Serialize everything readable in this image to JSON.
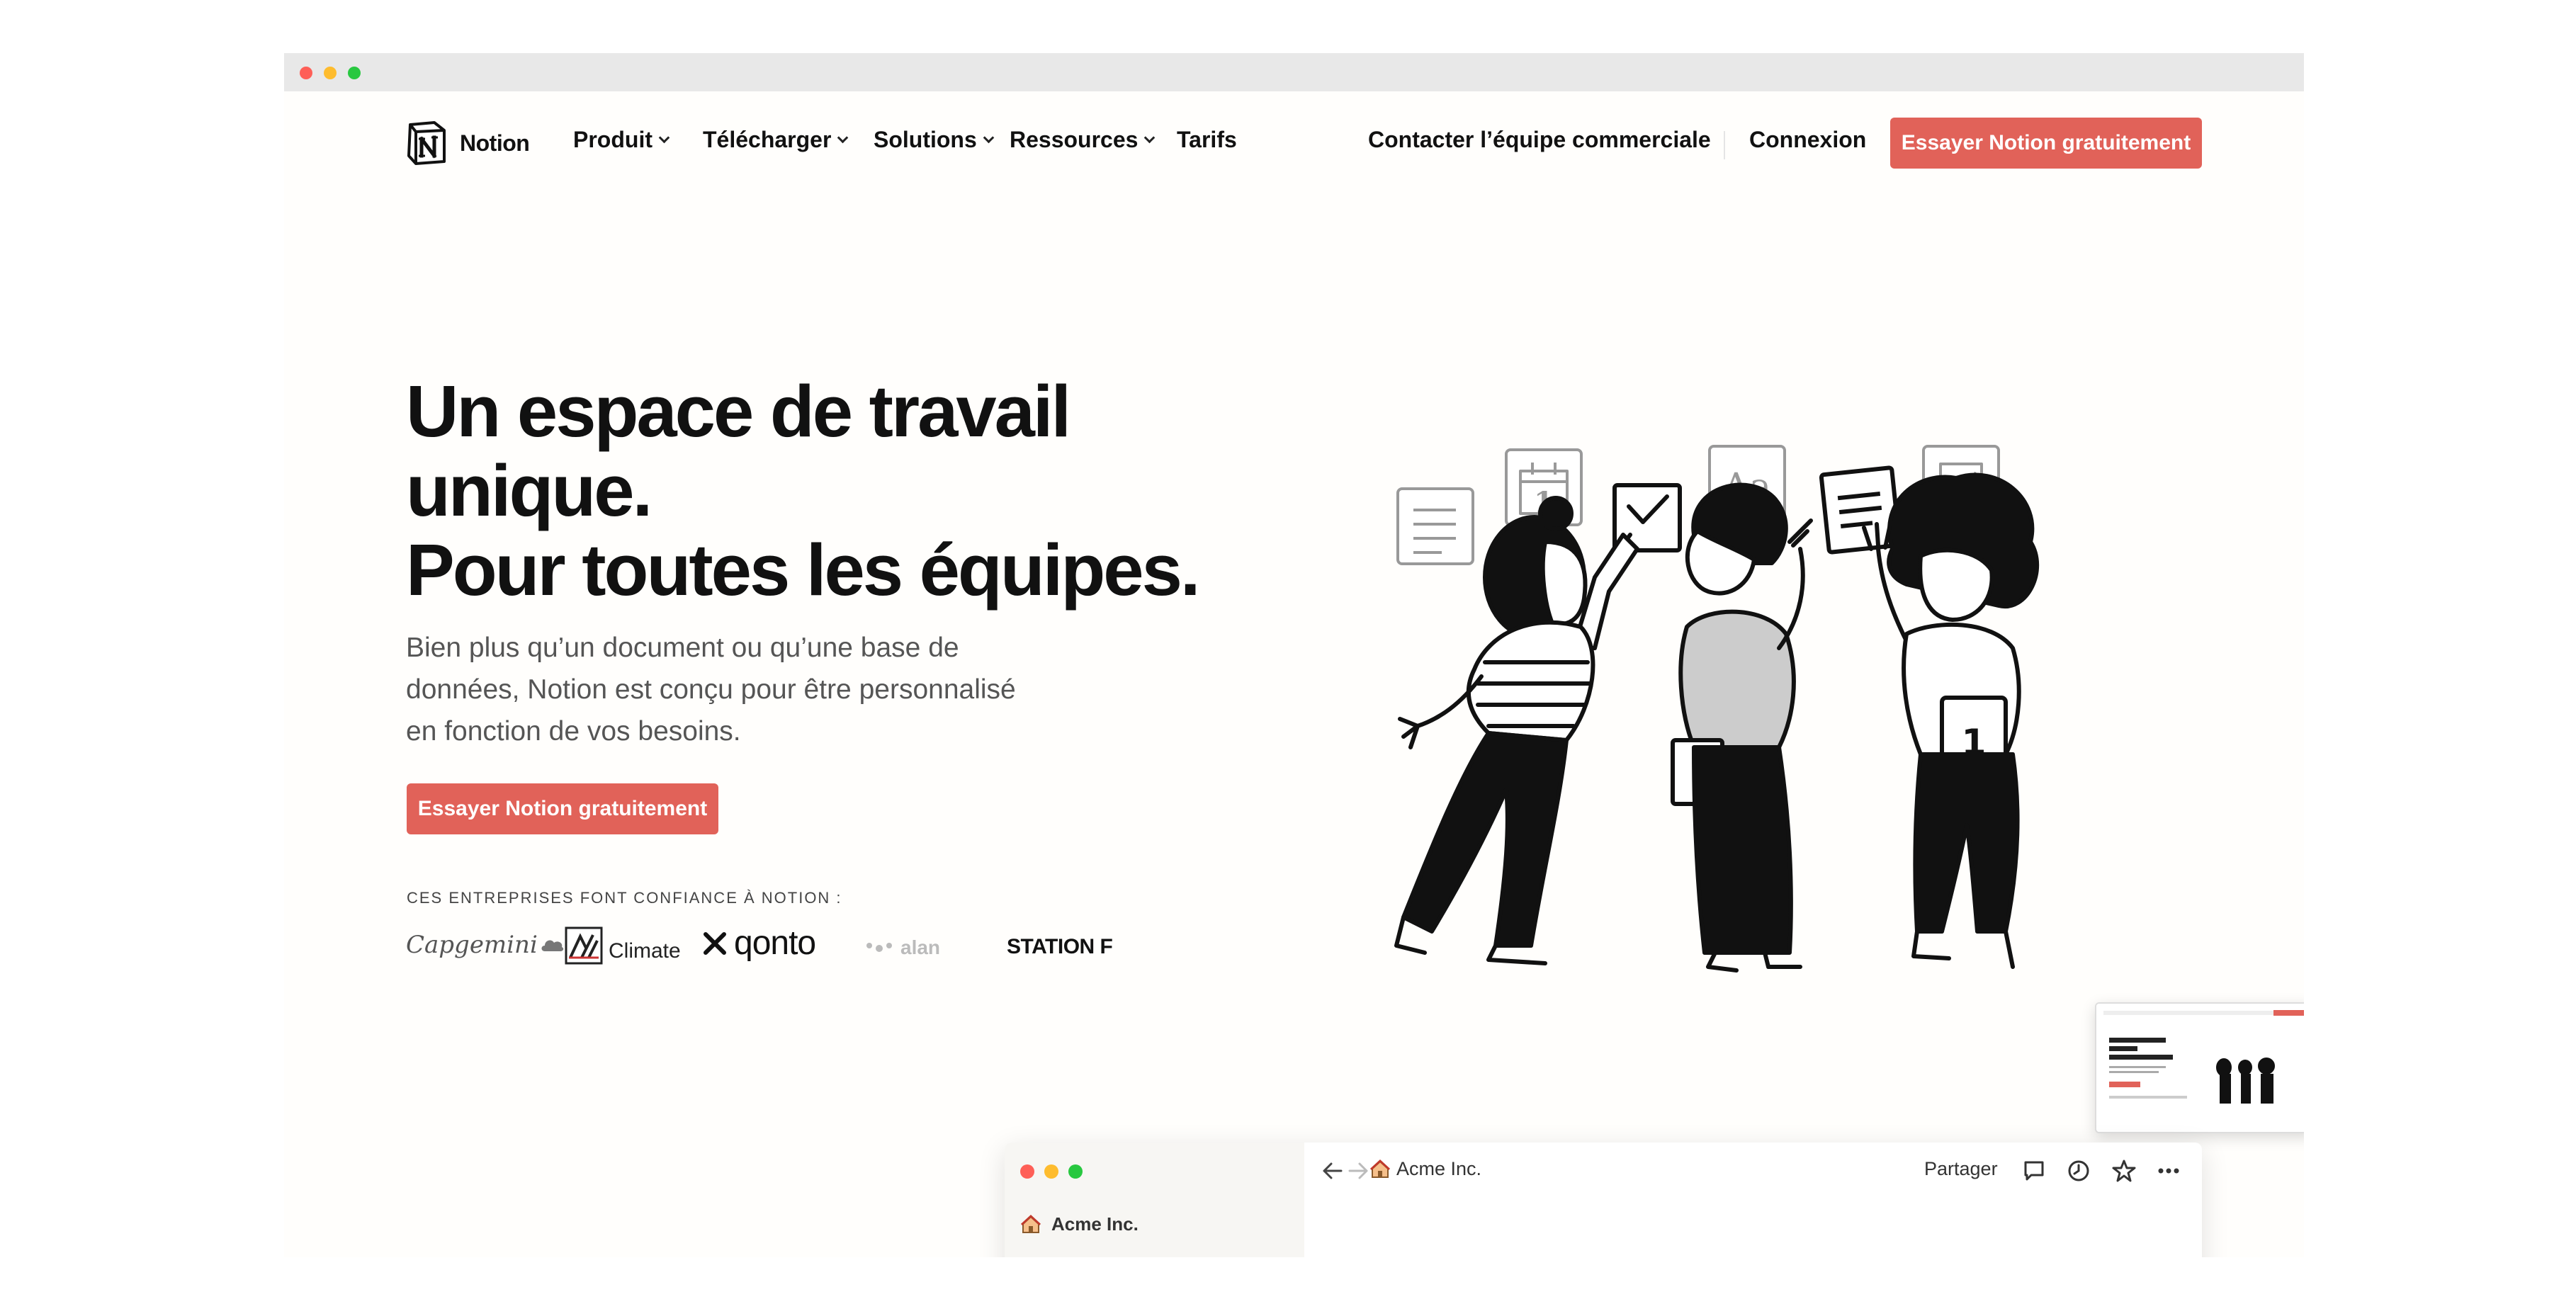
{
  "nav": {
    "brand": "Notion",
    "items": [
      {
        "label": "Produit",
        "has_menu": true
      },
      {
        "label": "Télécharger",
        "has_menu": true
      },
      {
        "label": "Solutions",
        "has_menu": true
      },
      {
        "label": "Ressources",
        "has_menu": true
      },
      {
        "label": "Tarifs",
        "has_menu": false
      }
    ],
    "contact": "Contacter l’équipe commerciale",
    "login": "Connexion",
    "cta": "Essayer Notion gratuitement"
  },
  "hero": {
    "title_lines": [
      "Un espace de travail",
      "unique.",
      "Pour toutes les équipes."
    ],
    "subtitle": "Bien plus qu’un document ou qu’une base de données, Notion est conçu pour être personnalisé en fonction de vos besoins.",
    "cta": "Essayer Notion gratuitement",
    "trust_label": "CES ENTREPRISES FONT CONFIANCE À NOTION :",
    "logos": [
      "Capgemini",
      "Climate",
      "qonto",
      "alan",
      "STATION F"
    ],
    "logo_axa_mark": "AXA"
  },
  "illustration": {
    "icon_calendar_day": "1",
    "icon_text_sample": "Aa"
  },
  "app_preview": {
    "workspace": "Acme Inc.",
    "breadcrumb": "Acme Inc.",
    "share": "Partager",
    "icons": [
      "back-arrow-icon",
      "forward-arrow-icon",
      "house-icon",
      "comment-icon",
      "clock-icon",
      "star-icon",
      "more-icon"
    ]
  },
  "colors": {
    "accent": "#e16259",
    "text": "#111111",
    "muted": "#555555",
    "page_bg": "#fffefc",
    "chrome_bg": "#e8e8e8"
  }
}
